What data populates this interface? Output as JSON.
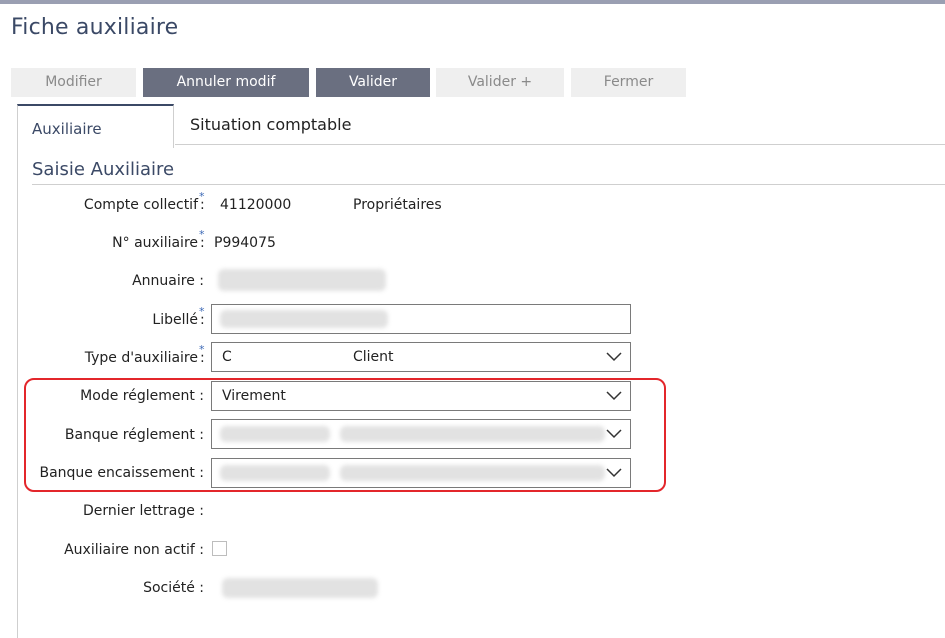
{
  "page": {
    "title": "Fiche auxiliaire"
  },
  "toolbar": {
    "modifier": "Modifier",
    "annuler_modif": "Annuler modif",
    "valider": "Valider",
    "valider_plus": "Valider +",
    "fermer": "Fermer"
  },
  "tabs": [
    {
      "label": "Auxiliaire",
      "active": true
    },
    {
      "label": "Situation comptable",
      "active": false
    }
  ],
  "section": {
    "title": "Saisie Auxiliaire"
  },
  "form": {
    "compte_collectif": {
      "label": "Compte collectif",
      "required": "*",
      "colon": ":",
      "code": "41120000",
      "name": "Propriétaires"
    },
    "no_auxiliaire": {
      "label": "N° auxiliaire",
      "required": "*",
      "colon": ":",
      "value": "P994075"
    },
    "annuaire": {
      "label": "Annuaire :"
    },
    "libelle": {
      "label": "Libellé",
      "required": "*",
      "colon": ":"
    },
    "type_auxiliaire": {
      "label": "Type d'auxiliaire",
      "required": "*",
      "colon": ":",
      "code": "C",
      "name": "Client"
    },
    "mode_reglement": {
      "label": "Mode réglement :",
      "value": "Virement"
    },
    "banque_reglement": {
      "label": "Banque réglement :"
    },
    "banque_encaissement": {
      "label": "Banque encaissement :"
    },
    "dernier_lettrage": {
      "label": "Dernier lettrage :"
    },
    "auxiliaire_non_actif": {
      "label": "Auxiliaire non actif :",
      "checked": false
    },
    "societe": {
      "label": "Société :"
    }
  },
  "icons": {
    "dropdown": "chevron-down-icon"
  },
  "colors": {
    "accent": "#3b4966",
    "primary_button": "#6a6f80",
    "highlight": "#e3262b",
    "required": "#3b68b5"
  }
}
